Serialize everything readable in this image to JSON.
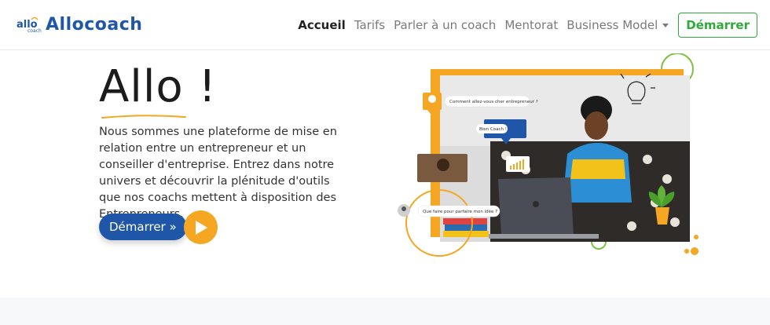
{
  "brand": {
    "name": "Allocoach",
    "logo_text": "allo",
    "logo_sub": "coach"
  },
  "nav": {
    "items": [
      {
        "label": "Accueil",
        "active": true
      },
      {
        "label": "Tarifs",
        "active": false
      },
      {
        "label": "Parler à un coach",
        "active": false
      },
      {
        "label": "Mentorat",
        "active": false
      },
      {
        "label": "Business Model",
        "active": false,
        "dropdown": true
      }
    ],
    "cta_label": "Démarrer"
  },
  "hero": {
    "title": "Allo !",
    "description": "Nous sommes une plateforme de mise en relation entre un entrepreneur et un conseiller d'entreprise. Entrez dans notre univers et découvrir la plénitude d'outils que nos coachs mettent à disposition des Entrepreneurs.",
    "button_label": "Démarrer »",
    "play_icon": "play-icon"
  },
  "illustration": {
    "bubbles": {
      "b1": "Comment allez-vous cher entrepreneur ?",
      "b2": "Bien Coach !",
      "b3": "Que faire pour parfaire mon idée ?"
    }
  },
  "colors": {
    "brand_blue": "#1f56a8",
    "accent_orange": "#f5a623",
    "accent_green": "#2eaa3b"
  }
}
